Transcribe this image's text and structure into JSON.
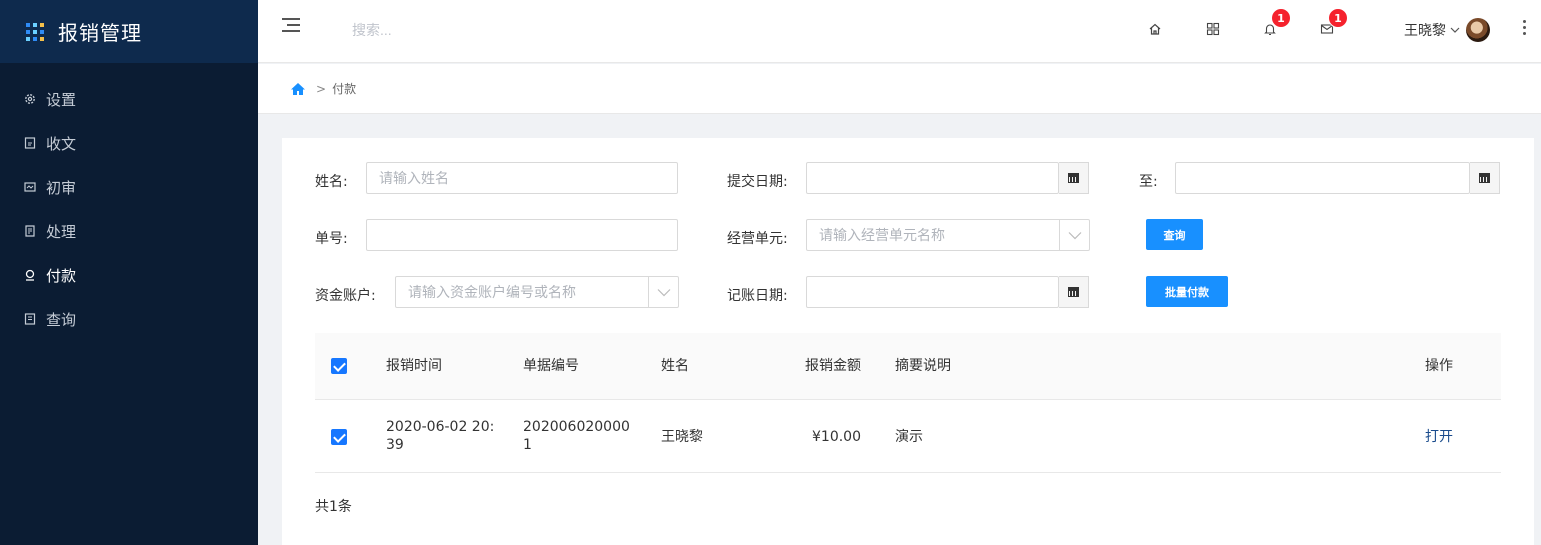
{
  "app": {
    "title": "报销管理"
  },
  "sidebar": {
    "items": [
      {
        "label": "设置",
        "icon": "gear-icon"
      },
      {
        "label": "收文",
        "icon": "document-icon"
      },
      {
        "label": "初审",
        "icon": "review-icon"
      },
      {
        "label": "处理",
        "icon": "process-icon"
      },
      {
        "label": "付款",
        "icon": "payment-icon",
        "active": true
      },
      {
        "label": "查询",
        "icon": "query-icon"
      }
    ]
  },
  "header": {
    "search_placeholder": "搜索...",
    "notifications_count": "1",
    "messages_count": "1",
    "user_name": "王晓黎"
  },
  "breadcrumb": {
    "current": "付款"
  },
  "form": {
    "name_label": "姓名:",
    "name_placeholder": "请输入姓名",
    "submit_date_label": "提交日期:",
    "to_label": "至:",
    "order_no_label": "单号:",
    "business_unit_label": "经营单元:",
    "business_unit_placeholder": "请输入经营单元名称",
    "query_button": "查询",
    "fund_account_label": "资金账户:",
    "fund_account_placeholder": "请输入资金账户编号或名称",
    "booking_date_label": "记账日期:",
    "batch_pay_button": "批量付款"
  },
  "table": {
    "columns": [
      "报销时间",
      "单据编号",
      "姓名",
      "报销金额",
      "摘要说明",
      "操作"
    ],
    "rows": [
      {
        "time_line1": "2020-06-02 20:",
        "time_line2": "39",
        "doc_no_line1": "202006020000",
        "doc_no_line2": "1",
        "name": "王晓黎",
        "amount": "¥10.00",
        "summary": "演示",
        "action": "打开"
      }
    ],
    "total": "共1条"
  },
  "colors": {
    "sidebar_bg": "#0b1c33",
    "logo_bg": "#0e2a4d",
    "primary": "#1890ff",
    "badge": "#f5222d"
  }
}
